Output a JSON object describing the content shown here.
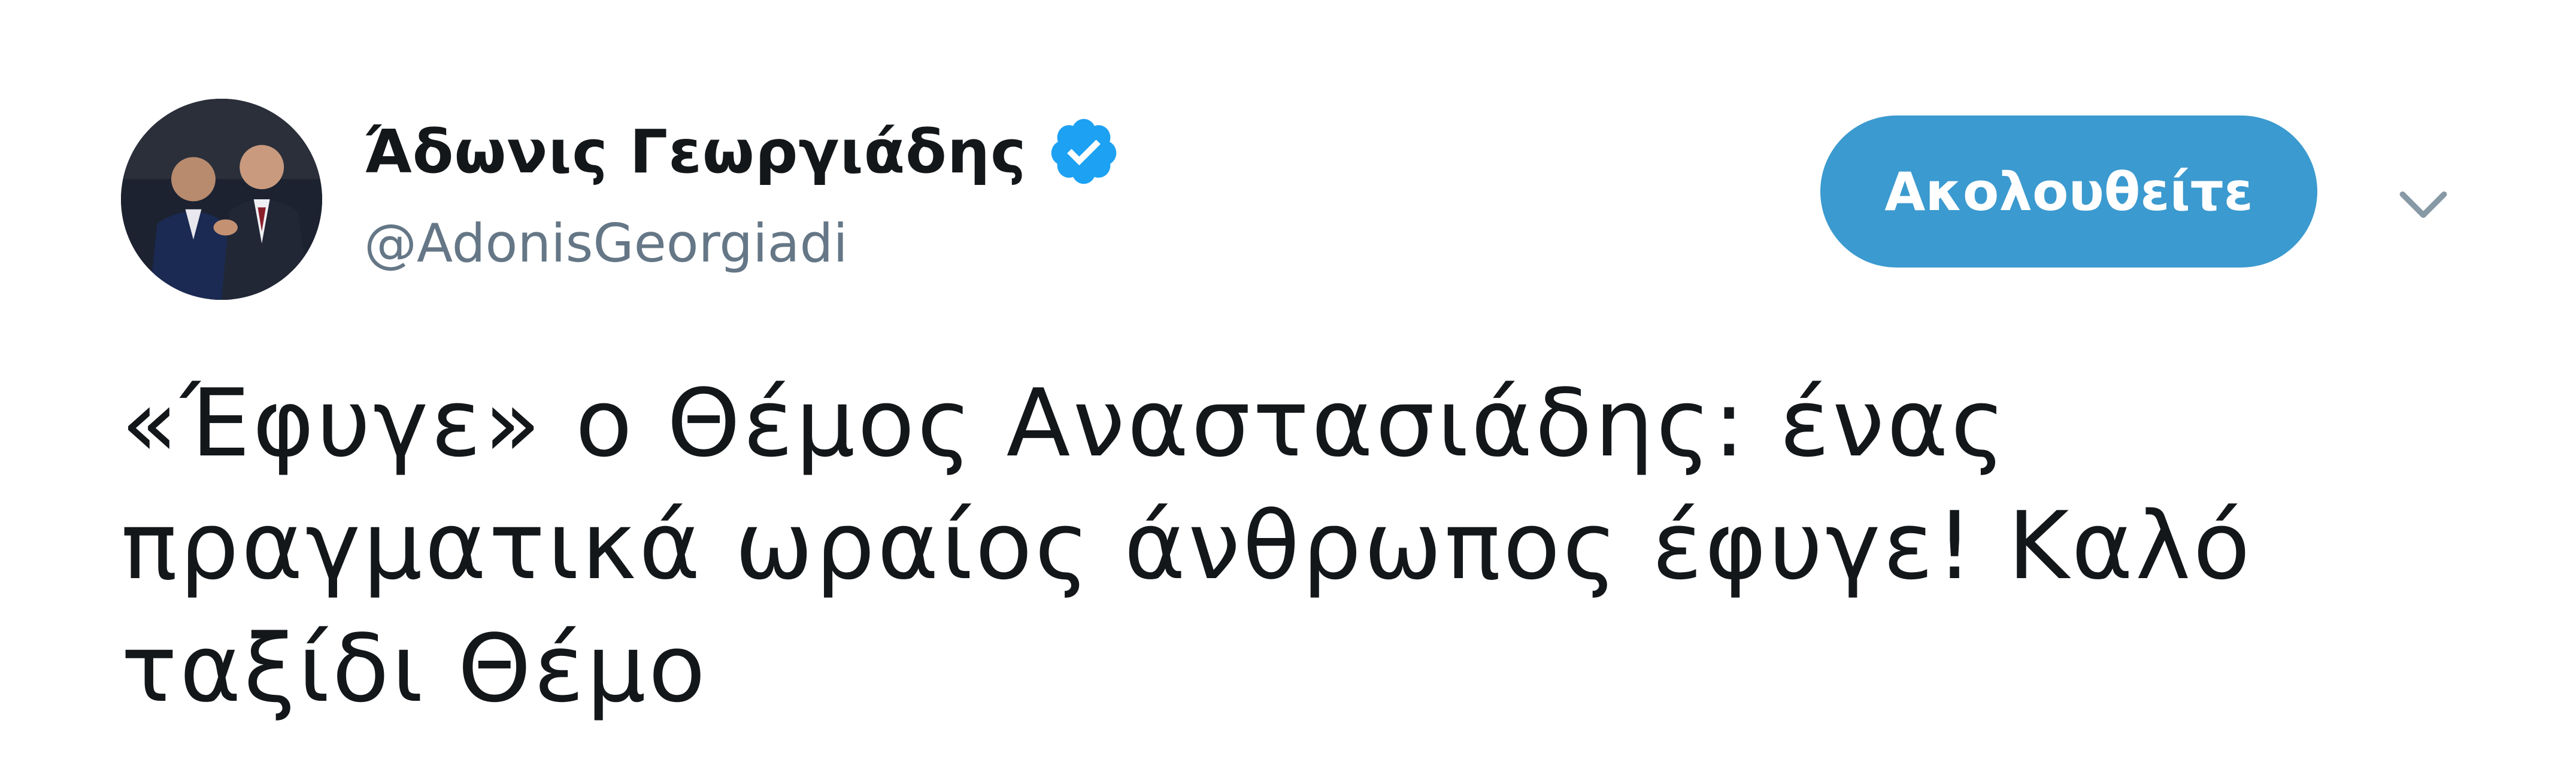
{
  "tweet": {
    "author": {
      "display_name": "Άδωνις Γεωργιάδης",
      "handle": "@AdonisGeorgiadi",
      "verified": true,
      "verified_icon": "verified-badge-icon",
      "avatar_icon": "profile-avatar"
    },
    "follow_button_label": "Ακολουθείτε",
    "menu_icon": "chevron-down-icon",
    "text_lines": [
      "«Έφυγε» ο Θέμος Αναστασιάδης: ένας",
      "πραγματικά ωραίος άνθρωπος έφυγε! Καλό",
      "ταξίδι Θέμο"
    ]
  },
  "colors": {
    "follow_button": "#3b9acf",
    "verified_badge": "#1da1f2",
    "handle_text": "#657786",
    "body_text": "#14171a"
  }
}
